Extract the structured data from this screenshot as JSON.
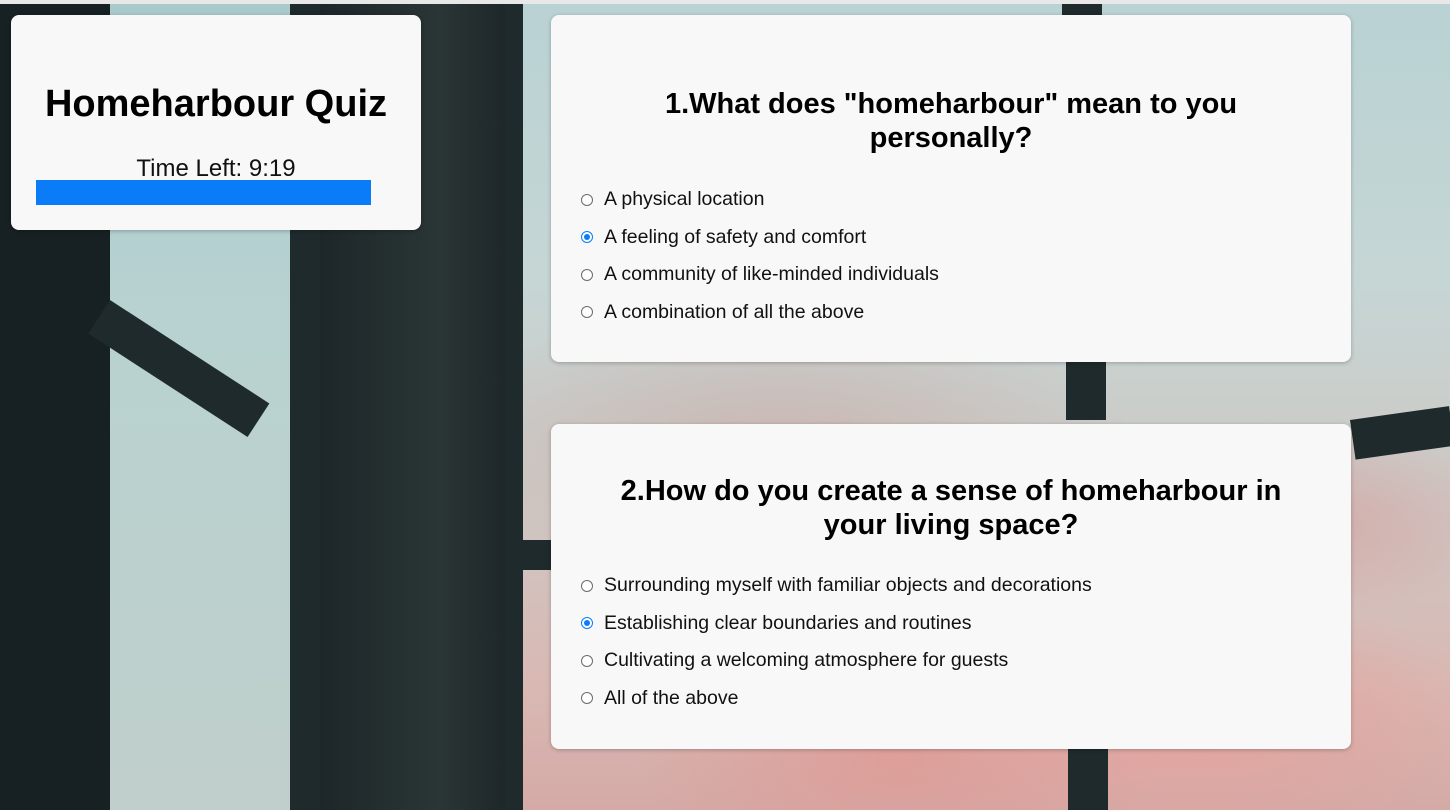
{
  "sidebar": {
    "title": "Homeharbour Quiz",
    "timer_label": "Time Left: 9:19",
    "progress_fraction": 1.0,
    "accent_color": "#0a7cf7"
  },
  "questions": [
    {
      "title": "1.What does \"homeharbour\" mean to you personally?",
      "options": [
        {
          "label": "A physical location",
          "selected": false
        },
        {
          "label": "A feeling of safety and comfort",
          "selected": true
        },
        {
          "label": "A community of like-minded individuals",
          "selected": false
        },
        {
          "label": "A combination of all the above",
          "selected": false
        }
      ]
    },
    {
      "title": "2.How do you create a sense of homeharbour in your living space?",
      "options": [
        {
          "label": "Surrounding myself with familiar objects and decorations",
          "selected": false
        },
        {
          "label": "Establishing clear boundaries and routines",
          "selected": true
        },
        {
          "label": "Cultivating a welcoming atmosphere for guests",
          "selected": false
        },
        {
          "label": "All of the above",
          "selected": false
        }
      ]
    }
  ]
}
